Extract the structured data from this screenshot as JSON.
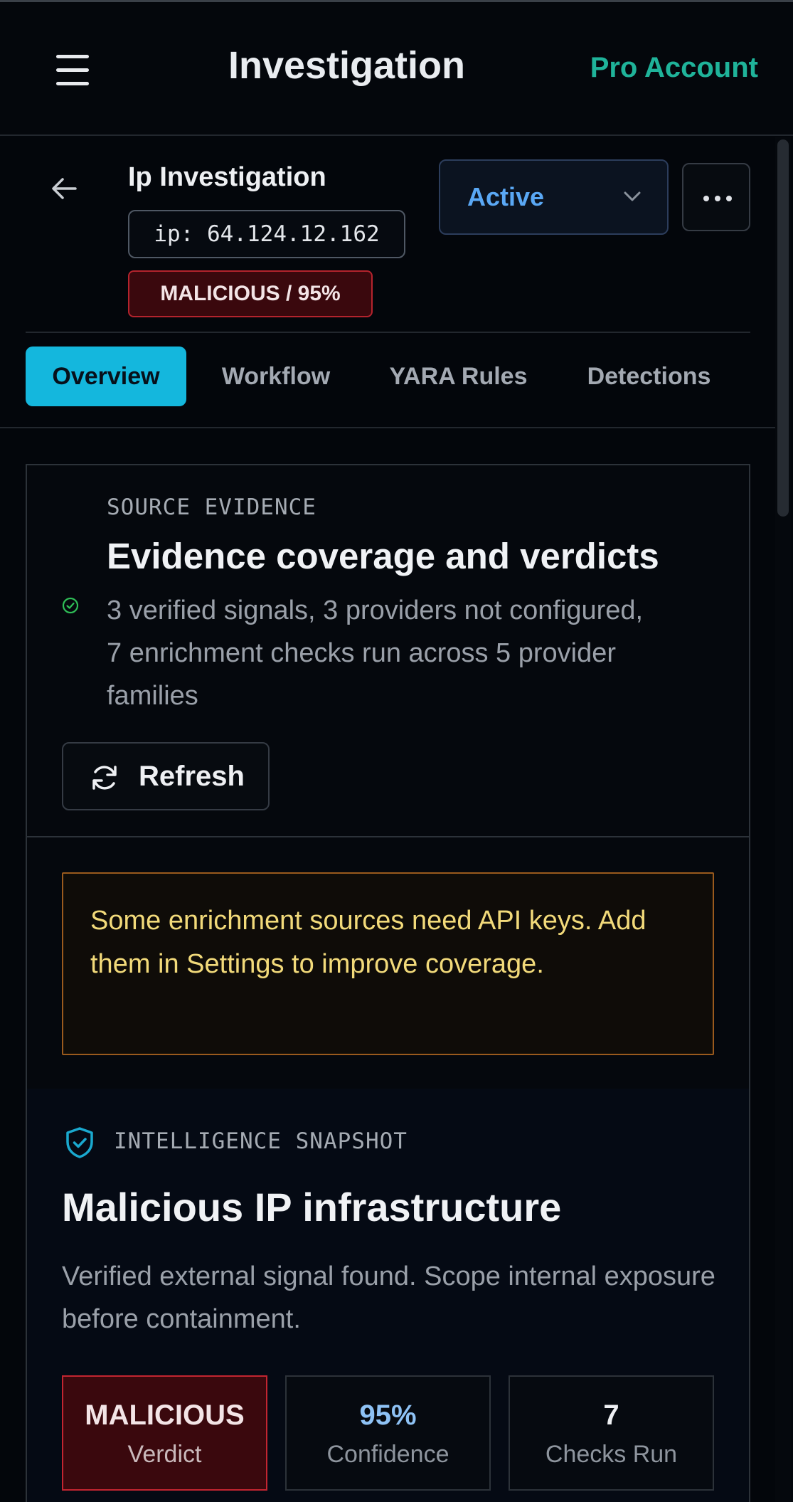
{
  "appbar": {
    "title": "Investigation",
    "account_label": "Pro Account"
  },
  "investigation": {
    "title": "Ip Investigation",
    "indicator": "ip: 64.124.12.162",
    "verdict_badge": "MALICIOUS / 95%",
    "status": "Active"
  },
  "tabs": [
    {
      "label": "Overview",
      "active": true
    },
    {
      "label": "Workflow",
      "active": false
    },
    {
      "label": "YARA Rules",
      "active": false
    },
    {
      "label": "Detections",
      "active": false
    }
  ],
  "evidence": {
    "eyebrow": "SOURCE EVIDENCE",
    "title": "Evidence coverage and verdicts",
    "description": "3 verified signals, 3 providers not configured, 7 enrichment checks run across 5 provider families",
    "refresh_label": "Refresh",
    "warning": "Some enrichment sources need API keys. Add them in Settings to improve coverage."
  },
  "snapshot": {
    "eyebrow": "INTELLIGENCE SNAPSHOT",
    "title": "Malicious IP infrastructure",
    "description": "Verified external signal found. Scope internal exposure before containment.",
    "stats": [
      {
        "value": "MALICIOUS",
        "label": "Verdict"
      },
      {
        "value": "95%",
        "label": "Confidence"
      },
      {
        "value": "7",
        "label": "Checks Run"
      }
    ]
  },
  "colors": {
    "accent_tab": "#14b7dd",
    "pro_account": "#1fb39a",
    "status_active": "#5aa8f5",
    "malicious": "#c32530",
    "warning_text": "#f2da7a",
    "confidence": "#8ec2f5"
  },
  "icons": {
    "menu": "hamburger-menu-icon",
    "back": "arrow-left-icon",
    "status_dropdown": "chevron-down-icon",
    "more": "more-horizontal-icon",
    "verified": "check-circle-icon",
    "refresh": "refresh-icon",
    "snapshot": "shield-check-icon"
  }
}
